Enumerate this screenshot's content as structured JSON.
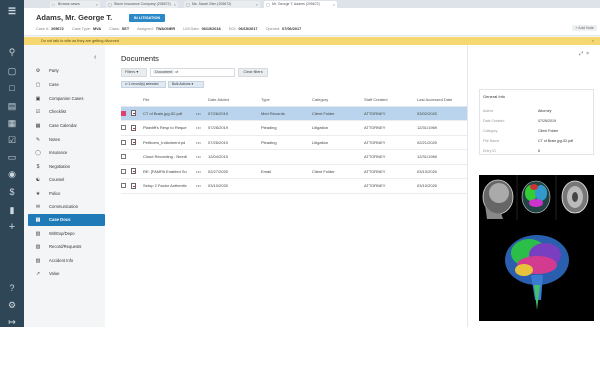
{
  "tabs": [
    {
      "label": "Browse cases",
      "active": false
    },
    {
      "label": "Storm Insurance Company (205672)",
      "active": false
    },
    {
      "label": "Ms. Sarah Glen (205672)",
      "active": false
    },
    {
      "label": "Mr. George T. Adams (205672)",
      "active": true
    }
  ],
  "header": {
    "case_name": "Adams, Mr. George T.",
    "badge": "IN LITIGATION",
    "meta": [
      {
        "label": "Case #:",
        "value": "205672"
      },
      {
        "label": "Case Type:",
        "value": "MVA"
      },
      {
        "label": "Class:",
        "value": "SET"
      },
      {
        "label": "Assigned:",
        "value": "TWAGNER"
      },
      {
        "label": "LIM Date:",
        "value": "06/15/2018"
      },
      {
        "label": "DOI:",
        "value": "06/15/2017"
      },
      {
        "label": "Opened:",
        "value": "07/06/2017"
      }
    ],
    "add_note": "+ Add Note"
  },
  "alert": "Do not talk to wife as they are getting divorced",
  "sidemenu": [
    {
      "label": "Party",
      "icon": "party-icon",
      "active": false
    },
    {
      "label": "Case",
      "icon": "briefcase-icon",
      "active": false
    },
    {
      "label": "Companion Cases",
      "icon": "companion-icon",
      "active": false
    },
    {
      "label": "Checklist",
      "icon": "checklist-icon",
      "active": false
    },
    {
      "label": "Case Calendar",
      "icon": "calendar-icon",
      "active": false
    },
    {
      "label": "Notes",
      "icon": "notes-icon",
      "active": false
    },
    {
      "label": "Insurance",
      "icon": "shield-icon",
      "active": false
    },
    {
      "label": "Negotiation",
      "icon": "dollar-icon",
      "active": false
    },
    {
      "label": "Counsel",
      "icon": "counsel-icon",
      "active": false
    },
    {
      "label": "Police",
      "icon": "police-icon",
      "active": false
    },
    {
      "label": "Communication",
      "icon": "communication-icon",
      "active": false
    },
    {
      "label": "Case Docs",
      "icon": "folder-icon",
      "active": true
    },
    {
      "label": "Wit/Exp/Depo",
      "icon": "witness-icon",
      "active": false
    },
    {
      "label": "Record/Requests",
      "icon": "records-icon",
      "active": false
    },
    {
      "label": "Accident Info",
      "icon": "accident-icon",
      "active": false
    },
    {
      "label": "Value",
      "icon": "value-icon",
      "active": false
    }
  ],
  "documents": {
    "title": "Documents",
    "filters_label": "Filters",
    "filter_chip_label": "Document",
    "filter_chip_value": "ct",
    "clear_filters": "Clear filters",
    "selected_badge": "1 record(s) selected",
    "bulk_actions": "Bulk Actions",
    "columns": [
      "File",
      "Date Added",
      "Type",
      "Category",
      "Staff Created",
      "Last Accessed Date"
    ],
    "rows": [
      {
        "checked": true,
        "file": "CT of Brain.jpg-52.pdf",
        "date_added": "07/26/2019",
        "type": "Med Records",
        "category": "Client Folder",
        "staff": "ATTORNEY",
        "last_accessed": "03/02/2020",
        "selected": true
      },
      {
        "checked": false,
        "file": "Plaintiff's Resp to Reque",
        "date_added": "07/26/2019",
        "type": "Pleading",
        "category": "Litigation",
        "staff": "ATTORNEY",
        "last_accessed": "12/31/1969",
        "selected": false
      },
      {
        "checked": false,
        "file": "PetItoers_Indictment.pd",
        "date_added": "07/26/2019",
        "type": "Pleading",
        "category": "Litigation",
        "staff": "ATTORNEY",
        "last_accessed": "02/21/2020",
        "selected": false
      },
      {
        "checked": false,
        "file": "Cloud Recording - Needl",
        "date_added": "12/04/2019",
        "type": "",
        "category": "",
        "staff": "ATTORNEY",
        "last_accessed": "12/31/1969",
        "selected": false
      },
      {
        "checked": false,
        "file": "RE: [FAMPA Enabled Sn",
        "date_added": "02/27/2020",
        "type": "Email",
        "category": "Client Folder",
        "staff": "ATTORNEY",
        "last_accessed": "03/10/2020",
        "selected": false
      },
      {
        "checked": false,
        "file": "Setup 2 Factor Authentic",
        "date_added": "03/10/2020",
        "type": "",
        "category": "",
        "staff": "ATTORNEY",
        "last_accessed": "03/10/2020",
        "selected": false
      }
    ]
  },
  "preview": {
    "info_title": "General Info",
    "fields": [
      {
        "label": "Author",
        "value": "Attorney"
      },
      {
        "label": "Date Created",
        "value": "07/26/2019"
      },
      {
        "label": "Category",
        "value": "Client Folder"
      },
      {
        "label": "File Name",
        "value": "CT of Brain.jpg-52.pdf"
      },
      {
        "label": "Entry ID",
        "value": "8"
      }
    ]
  },
  "colors": {
    "rail": "#2f4656",
    "accent": "#1f7ab8",
    "alert": "#f6d872",
    "selected_row": "#b9d4ec",
    "badge": "#2c89c7"
  }
}
